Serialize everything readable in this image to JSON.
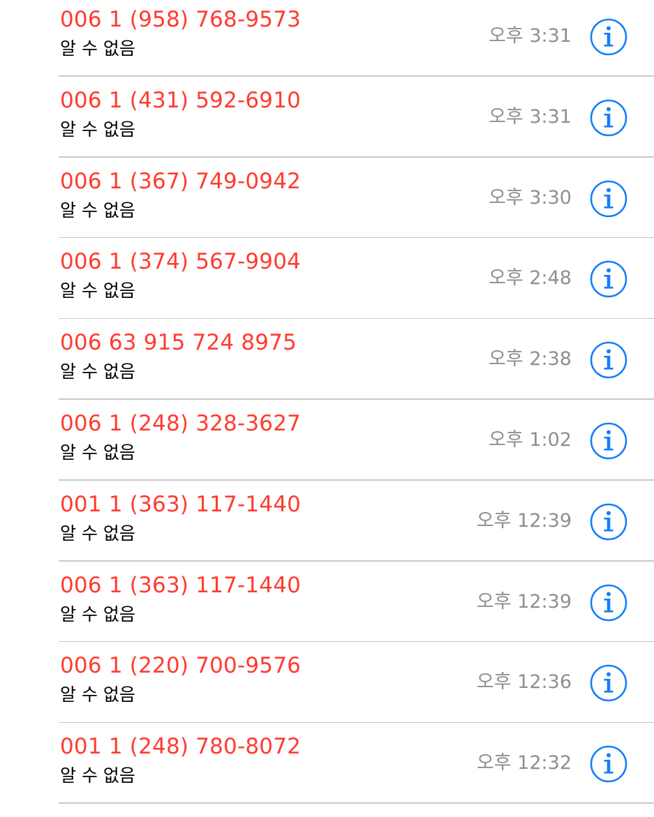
{
  "colors": {
    "missed_call_red": "#ff3b30",
    "time_gray": "#8e8e93",
    "info_blue": "#147efb",
    "separator": "#c8c7cc"
  },
  "calls": [
    {
      "number": "006 1 (958) 768-9573",
      "label": "알 수 없음",
      "time": "오후 3:31",
      "info_icon": "info-icon"
    },
    {
      "number": "006 1 (431) 592-6910",
      "label": "알 수 없음",
      "time": "오후 3:31",
      "info_icon": "info-icon"
    },
    {
      "number": "006 1 (367) 749-0942",
      "label": "알 수 없음",
      "time": "오후 3:30",
      "info_icon": "info-icon"
    },
    {
      "number": "006 1 (374) 567-9904",
      "label": "알 수 없음",
      "time": "오후 2:48",
      "info_icon": "info-icon"
    },
    {
      "number": "006 63 915 724 8975",
      "label": "알 수 없음",
      "time": "오후 2:38",
      "info_icon": "info-icon"
    },
    {
      "number": "006 1 (248) 328-3627",
      "label": "알 수 없음",
      "time": "오후 1:02",
      "info_icon": "info-icon"
    },
    {
      "number": "001 1 (363) 117-1440",
      "label": "알 수 없음",
      "time": "오후 12:39",
      "info_icon": "info-icon"
    },
    {
      "number": "006 1 (363) 117-1440",
      "label": "알 수 없음",
      "time": "오후 12:39",
      "info_icon": "info-icon"
    },
    {
      "number": "006 1 (220) 700-9576",
      "label": "알 수 없음",
      "time": "오후 12:36",
      "info_icon": "info-icon"
    },
    {
      "number": "001 1 (248) 780-8072",
      "label": "알 수 없음",
      "time": "오후 12:32",
      "info_icon": "info-icon"
    }
  ]
}
